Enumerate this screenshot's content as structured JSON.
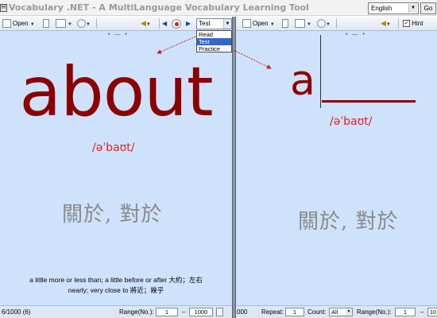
{
  "app": {
    "title": "Vocabulary .NET - A MultiLanguage Vocabulary Learning Tool",
    "icon_glyph": "H",
    "language": "English",
    "go_label": "Go"
  },
  "left_pane": {
    "toolbar": {
      "open_label": "Open",
      "mode_value": "Test",
      "mode_options": [
        "Read",
        "Test",
        "Practice"
      ],
      "mode_selected_index": 1,
      "dots": "• — •"
    },
    "word": "about",
    "phonetic": "/əˈbaʊt/",
    "meaning": "關於, 對於",
    "definition_line1": "a little more or less than; a little before or after 大約；左右",
    "definition_line2": "nearly; very close to 將近；幾乎",
    "status": {
      "position": "6/1000 (6)",
      "range_label": "Range(No.):",
      "range_from": "1",
      "range_sep": "–",
      "range_to": "1000"
    }
  },
  "right_pane": {
    "toolbar": {
      "open_label": "Open",
      "hint_label": "Hint",
      "hint_checked": true,
      "dots": "• — •"
    },
    "practice_letter": "a",
    "phonetic": "/əˈbaʊt/",
    "meaning": "關於, 對於",
    "status": {
      "position": "000",
      "repeat_label": "Repeat:",
      "repeat_value": "1",
      "count_label": "Count:",
      "count_value": "All",
      "range_label": "Range(No.):",
      "range_from": "1",
      "range_sep": "–",
      "range_to": "10"
    }
  },
  "colors": {
    "word": "#8b0000",
    "phonetic": "#e22020",
    "meaning": "#8a8a8a",
    "pane_bg": "#cfe2fb",
    "annotation_arrow": "#cc2020"
  }
}
